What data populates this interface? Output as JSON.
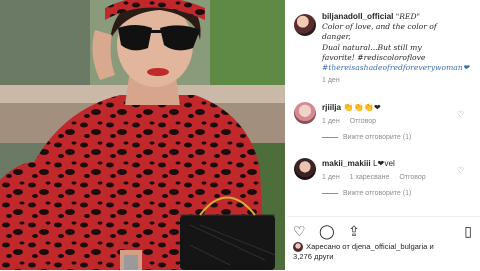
{
  "post": {
    "username": "biljanadoll_official",
    "caption_lines": [
      "\"RED\"",
      "Color of love, and the color of",
      "danger,",
      "Dual natural...But still my",
      "favorite! #rediscoloroflove"
    ],
    "hashtag_line": "#thereisashadeofredforeverywoman❤",
    "time": "1 ден"
  },
  "comments": [
    {
      "username": "rjiilja",
      "text": "👏👏👏❤",
      "time": "1 ден",
      "reply_label": "Отговор",
      "likes": "",
      "replies": "Вижте отговорите (1)"
    },
    {
      "username": "makii_makiii",
      "text": "L❤vel",
      "time": "1 ден",
      "likes": "1 харесване",
      "reply_label": "Отговор",
      "replies": "Вижте отговорите (1)"
    }
  ],
  "icons": {
    "like": "heart-outline-icon",
    "comment": "comment-icon",
    "share": "share-icon",
    "save": "bookmark-icon"
  },
  "likes": {
    "text_line1": "Харесано от djena_official_bulgaria и",
    "text_line2": "3,276 други"
  },
  "colors": {
    "hashtag": "#3c6fae",
    "muted": "#8e8e8e",
    "photo_dress": "#c0282b"
  }
}
